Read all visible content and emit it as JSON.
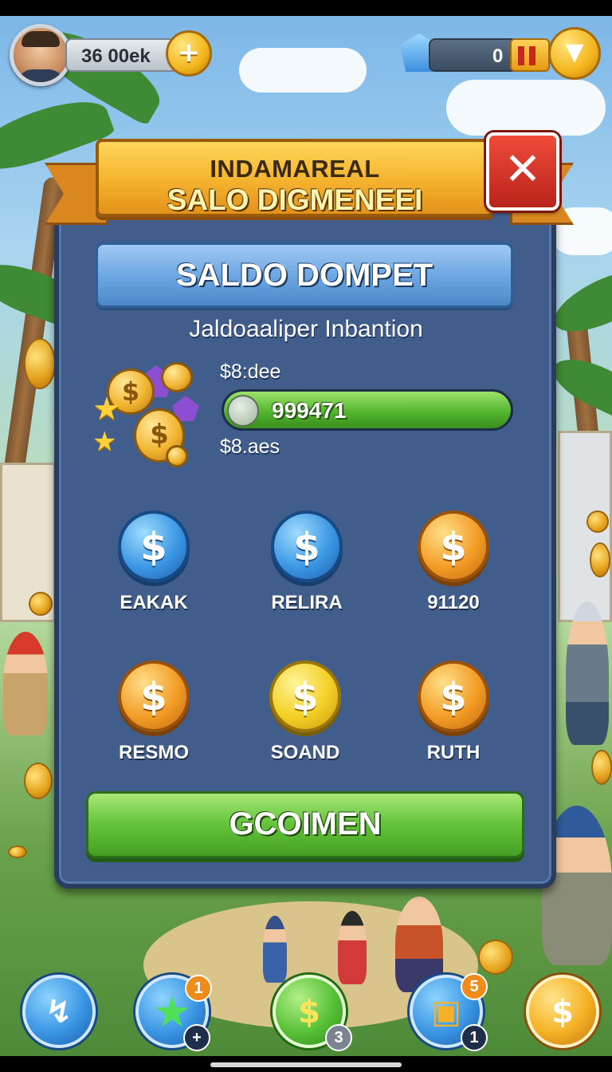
{
  "top_bar": {
    "coin_amount": "36 00ek",
    "plus_symbol": "+",
    "gem_amount": "0"
  },
  "dialog": {
    "title_line1": "INDAMAREAL",
    "title_line2": "SALO DIGMENEEI",
    "close_symbol": "✕",
    "header": "SALDO DOMPET",
    "info_title": "Jaldoaaliper Inbantion",
    "balance_top": "$8:dee",
    "balance_value": "999471",
    "balance_fraction": 1.0,
    "balance_bottom": "$8.aes",
    "options": [
      {
        "label": "EAKAK",
        "symbol": "$",
        "color": "blue"
      },
      {
        "label": "RELIRA",
        "symbol": "$",
        "color": "blue"
      },
      {
        "label": "91120",
        "symbol": "$",
        "color": "orange"
      },
      {
        "label": "RESMO",
        "symbol": "$",
        "color": "orange"
      },
      {
        "label": "SOAND",
        "symbol": "$",
        "color": "yellow"
      },
      {
        "label": "RUTH",
        "symbol": "$",
        "color": "orange"
      }
    ],
    "confirm_label": "GCOIMEN"
  },
  "bottom_nav": {
    "items": [
      {
        "icon": "boost-icon",
        "symbol": "↯"
      },
      {
        "icon": "star-icon",
        "symbol": "★",
        "badge_top": "1",
        "badge_bottom": "+"
      },
      {
        "icon": "dollar-icon",
        "symbol": "$",
        "badge_bottom": "3"
      },
      {
        "icon": "shop-bag-icon",
        "symbol": "▣",
        "badge_top": "5",
        "badge_bottom": "1"
      },
      {
        "icon": "gold-dollar-icon",
        "symbol": "$"
      }
    ]
  },
  "colors": {
    "panel": "#405d8b",
    "banner_gold": "#f6b631",
    "close_red": "#d8362a",
    "confirm_green": "#63c23a"
  }
}
